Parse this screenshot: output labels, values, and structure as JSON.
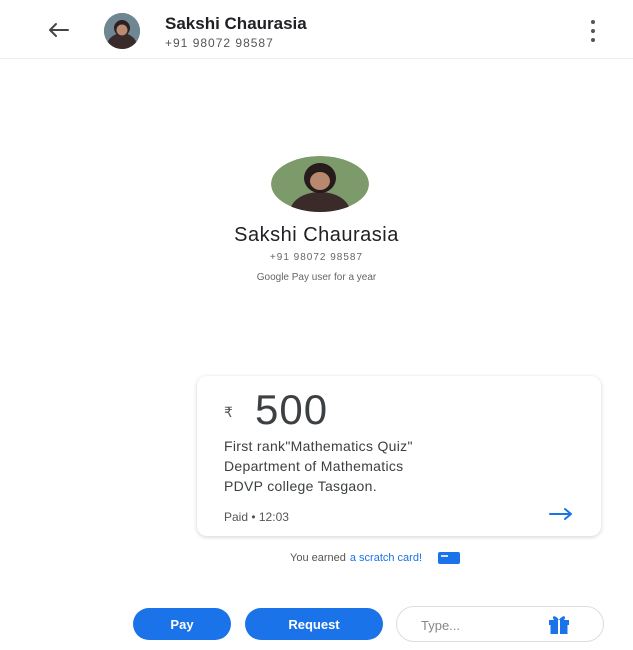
{
  "header": {
    "contact_name": "Sakshi Chaurasia",
    "contact_phone": "+91 98072 98587",
    "back_icon": "arrow-left-icon",
    "menu_icon": "more-vert-icon"
  },
  "profile": {
    "name": "Sakshi Chaurasia",
    "phone": "+91 98072 98587",
    "meta": "Google Pay user for a year",
    "avatar_icon": "avatar-photo"
  },
  "payment": {
    "currency": "₹",
    "amount": "500",
    "note_lines": [
      "First rank\"Mathematics Quiz\"",
      "Department of Mathematics",
      "PDVP college Tasgaon."
    ],
    "status": "Paid • 12:03",
    "arrow_icon": "arrow-right-icon"
  },
  "reward": {
    "prefix": "You earned",
    "link": "a scratch card!",
    "icon": "scratch-card-icon"
  },
  "actions": {
    "pay_label": "Pay",
    "request_label": "Request",
    "type_placeholder": "Type...",
    "gift_icon": "gift-icon"
  },
  "colors": {
    "accent": "#1a73e8",
    "text": "#202124"
  }
}
